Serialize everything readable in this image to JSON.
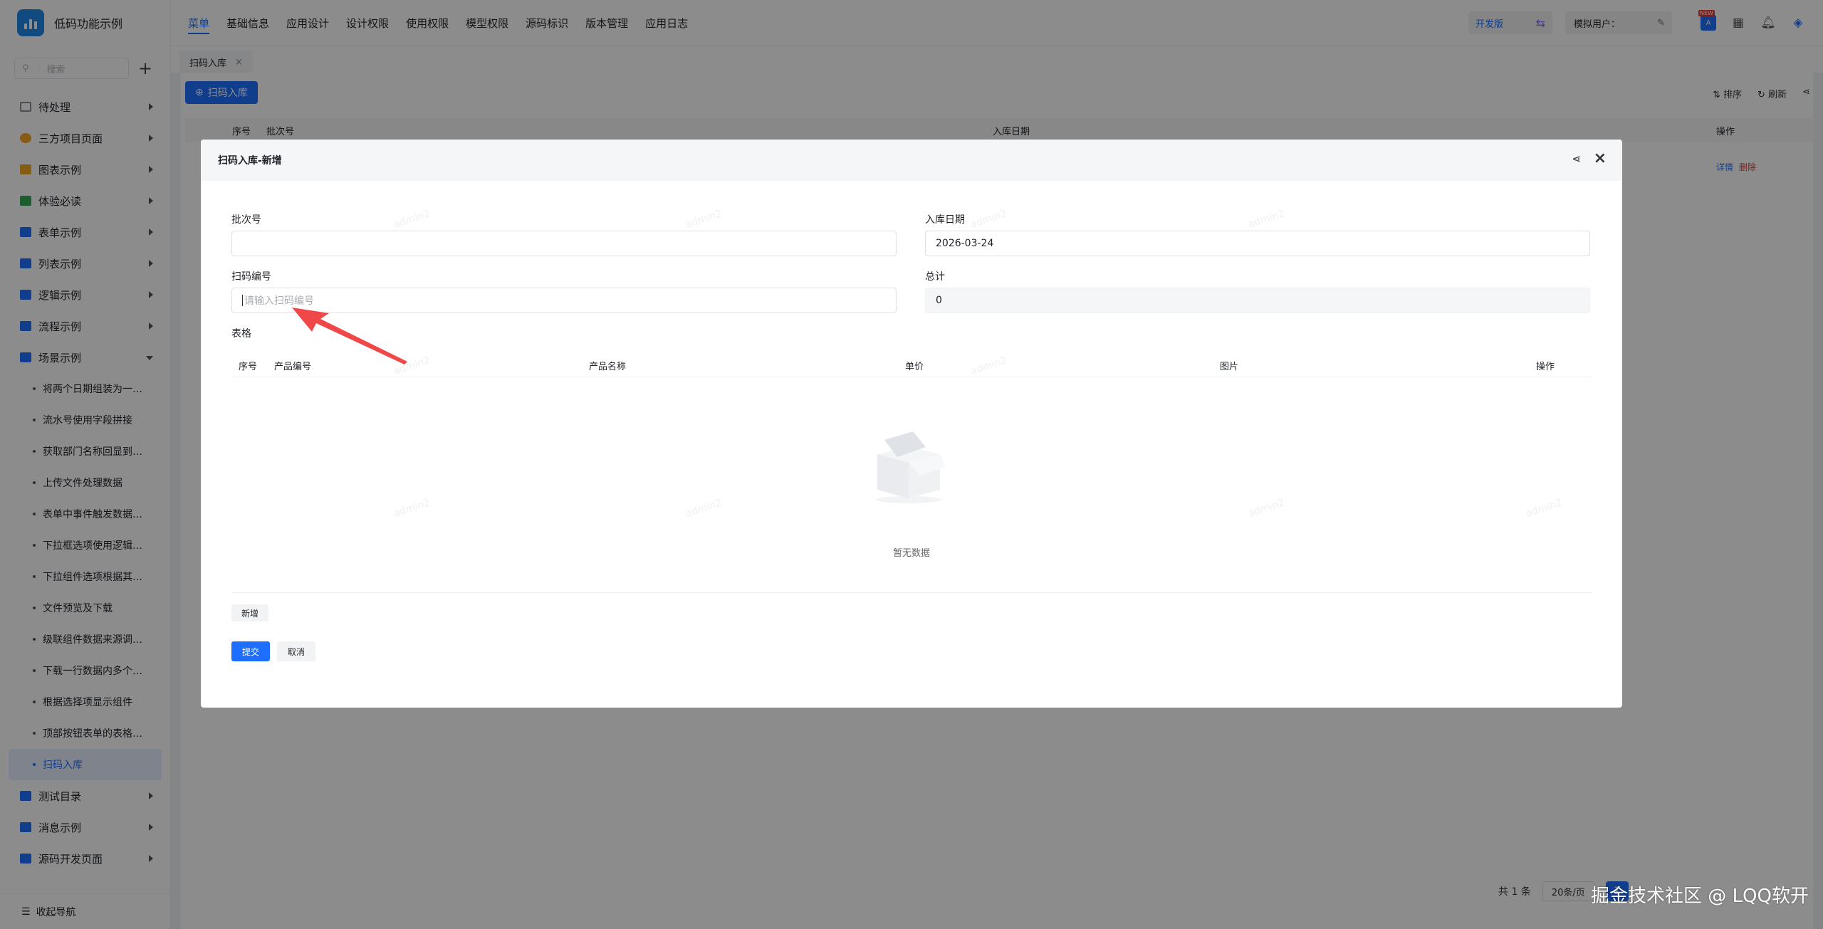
{
  "app": {
    "title": "低码功能示例"
  },
  "sidebar": {
    "search_placeholder": "搜索",
    "items": [
      {
        "label": "待处理",
        "color": "#8a8f99"
      },
      {
        "label": "三方项目页面",
        "color": "#f5a623"
      },
      {
        "label": "图表示例",
        "color": "#f5a623"
      },
      {
        "label": "体验必读",
        "color": "#34a853"
      },
      {
        "label": "表单示例",
        "color": "#1e6fff"
      },
      {
        "label": "列表示例",
        "color": "#1e6fff"
      },
      {
        "label": "逻辑示例",
        "color": "#1e6fff"
      },
      {
        "label": "流程示例",
        "color": "#1e6fff"
      },
      {
        "label": "场景示例",
        "color": "#1e6fff"
      }
    ],
    "sub_items": [
      "将两个日期组装为一…",
      "流水号使用字段拼接",
      "获取部门名称回显到…",
      "上传文件处理数据",
      "表单中事件触发数据…",
      "下拉框选项使用逻辑…",
      "下拉组件选项根据其…",
      "文件预览及下载",
      "级联组件数据来源调…",
      "下载一行数据内多个…",
      "根据选择项显示组件",
      "顶部按钮表单的表格…",
      "扫码入库"
    ],
    "bottom_items": [
      {
        "label": "测试目录",
        "color": "#1e6fff"
      },
      {
        "label": "消息示例",
        "color": "#1e6fff"
      },
      {
        "label": "源码开发页面",
        "color": "#1e6fff"
      }
    ],
    "collapse_label": "收起导航"
  },
  "topnav": {
    "items": [
      "菜单",
      "基础信息",
      "应用设计",
      "设计权限",
      "使用权限",
      "模型权限",
      "源码标识",
      "版本管理",
      "应用日志"
    ],
    "env": "开发版",
    "user_label": "模拟用户：",
    "badge": "NEW"
  },
  "tabs": {
    "current": "扫码入库"
  },
  "page": {
    "add_button": "扫码入库",
    "sort": "排序",
    "refresh": "刷新",
    "columns": [
      "序号",
      "批次号",
      "入库日期",
      "操作"
    ],
    "row_actions": {
      "detail": "详情",
      "delete": "删除"
    },
    "pagination": {
      "total": "共 1 条",
      "page_size": "20条/页",
      "current_page": "1"
    }
  },
  "dialog": {
    "title": "扫码入库-新增",
    "batch_label": "批次号",
    "batch_value": "",
    "date_label": "入库日期",
    "date_value": "2026-03-24",
    "scan_label": "扫码编号",
    "scan_placeholder": "请输入扫码编号",
    "total_label": "总计",
    "total_value": "0",
    "table_label": "表格",
    "table_columns": [
      "序号",
      "产品编号",
      "产品名称",
      "单价",
      "图片",
      "操作"
    ],
    "empty_text": "暂无数据",
    "add_row_button": "新增",
    "submit": "提交",
    "cancel": "取消",
    "watermark": "admin2"
  },
  "credit": "掘金技术社区 @ LQQ软开"
}
